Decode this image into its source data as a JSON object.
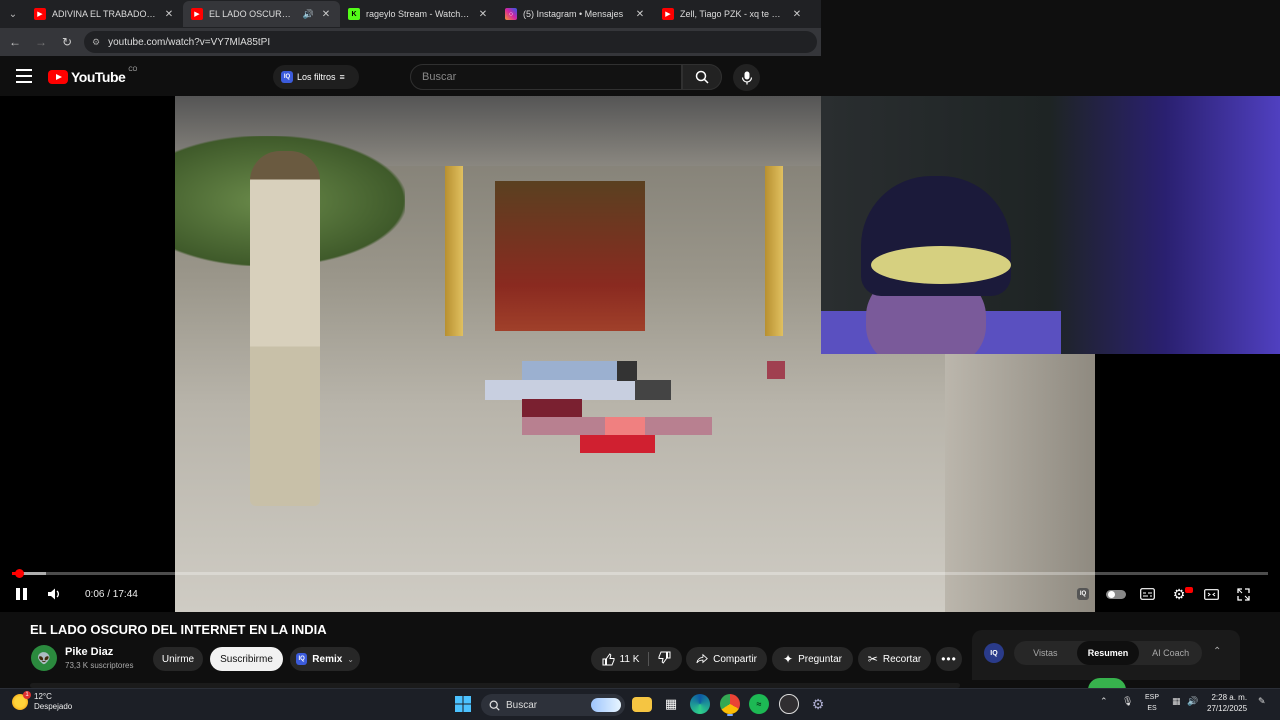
{
  "browser": {
    "tabs": [
      {
        "title": "ADIVINA EL TRABADO... - YouTube",
        "favicon": "youtube-favicon",
        "favicon_color": "#ff0000",
        "active": false
      },
      {
        "title": "EL LADO OSCURO DEL INTERNET",
        "favicon": "youtube-favicon",
        "favicon_color": "#ff0000",
        "active": true,
        "audio": true
      },
      {
        "title": "rageylo Stream - Watch Live on Kick",
        "favicon": "kick-favicon",
        "favicon_color": "#53fc18",
        "active": false
      },
      {
        "title": "(5) Instagram • Mensajes",
        "favicon": "instagram-favicon",
        "favicon_color": "#d6249f",
        "active": false
      },
      {
        "title": "Zell, Tiago PZK - xq te enamoraste",
        "favicon": "youtube-favicon",
        "favicon_color": "#ff0000",
        "active": false
      }
    ],
    "url": "youtube.com/watch?v=VY7MlA85tPI"
  },
  "youtube": {
    "logo_text": "YouTube",
    "country_code": "CO",
    "filters_label": "Los filtros",
    "search_placeholder": "Buscar"
  },
  "player": {
    "current_time": "0:06",
    "duration": "17:44",
    "time_display": "0:06 / 17:44",
    "progress_fraction": 0.0056,
    "buffered_fraction": 0.027,
    "state": "playing"
  },
  "video": {
    "title": "EL LADO OSCURO DEL INTERNET EN LA INDIA",
    "channel": "Pike Diaz",
    "subscribers": "73,3 K suscriptores",
    "join_label": "Unirme",
    "subscribe_label": "Suscribirme",
    "remix_label": "Remix",
    "likes": "11 K",
    "share_label": "Compartir",
    "ask_label": "Preguntar",
    "clip_label": "Recortar"
  },
  "side_panel": {
    "tabs": [
      "Vistas",
      "Resumen",
      "AI Coach"
    ],
    "active_tab": "Resumen"
  },
  "taskbar": {
    "temperature": "12°C",
    "weather": "Despejado",
    "search_label": "Buscar",
    "lang_primary": "ESP",
    "lang_secondary": "ES",
    "time": "2:28 a. m.",
    "date": "27/12/2025"
  },
  "colors": {
    "youtube_red": "#ff0000",
    "background": "#0f0f0f",
    "chrome_dark": "#202124"
  }
}
